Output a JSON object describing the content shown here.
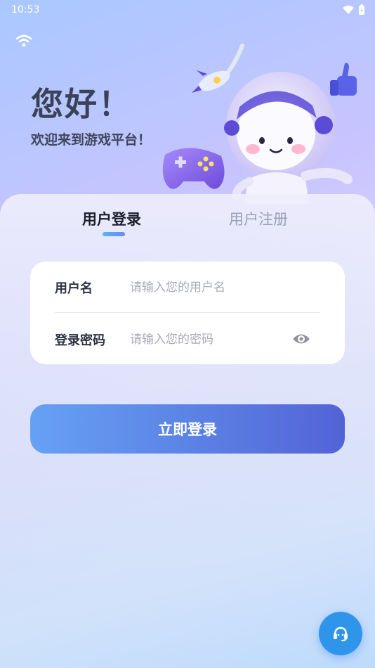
{
  "status_bar": {
    "time": "10:53"
  },
  "hero": {
    "title": "您好！",
    "subtitle": "欢迎来到游戏平台！"
  },
  "tabs": [
    {
      "label": "用户登录",
      "active": true
    },
    {
      "label": "用户注册",
      "active": false
    }
  ],
  "form": {
    "username_label": "用户名",
    "username_placeholder": "请输入您的用户名",
    "password_label": "登录密码",
    "password_placeholder": "请输入您的密码"
  },
  "login_button_label": "立即登录",
  "colors": {
    "accent": "#5b80e4",
    "support": "#2f95ea",
    "tab_indicator": "#59b6f5"
  },
  "icons": [
    "wifi-icon",
    "battery-icon",
    "eye-icon",
    "headset-icon",
    "astronaut-illustration"
  ]
}
